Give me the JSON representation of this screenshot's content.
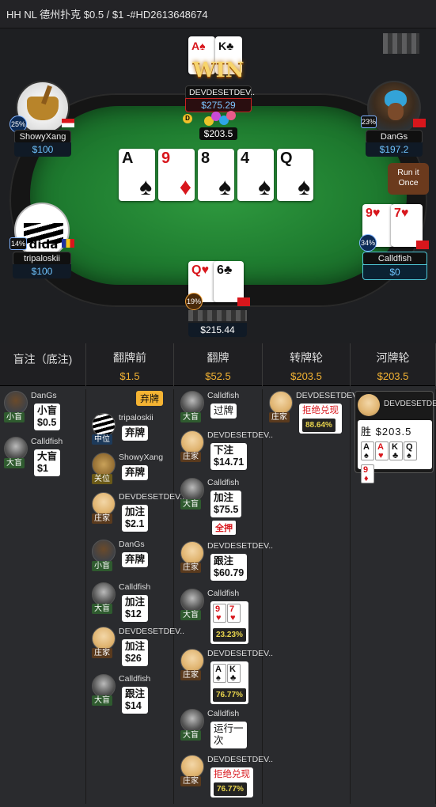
{
  "header": {
    "title": "HH NL 德州扑克 $0.5 / $1 -#HD2613648674"
  },
  "table": {
    "board": [
      {
        "rank": "A",
        "suit": "♠",
        "color": "#111111"
      },
      {
        "rank": "9",
        "suit": "♦",
        "color": "#d8161c"
      },
      {
        "rank": "8",
        "suit": "♠",
        "color": "#111111"
      },
      {
        "rank": "4",
        "suit": "♠",
        "color": "#111111"
      },
      {
        "rank": "Q",
        "suit": "♠",
        "color": "#111111"
      }
    ],
    "pot": "$203.5",
    "dealer_button": "D",
    "run_it_once": "Run it Once",
    "win_label": "WIN",
    "seats": {
      "top": {
        "name": "DEVDESETDEV..",
        "stack": "$275.29",
        "cards": [
          "A♠",
          "K♣"
        ]
      },
      "upper_left": {
        "name": "ShowyXang",
        "stack": "$100",
        "pct": "25%"
      },
      "upper_right": {
        "name": "DanGs",
        "stack": "$197.2",
        "pct": "23%"
      },
      "mid_left": {
        "name": "tripaloskii",
        "stack": "$100",
        "pct": "14%"
      },
      "mid_right": {
        "name": "Calldfish",
        "stack": "$0",
        "pct": "34%",
        "cards": [
          "9♥",
          "7♥"
        ]
      },
      "bottom": {
        "stack": "$215.44",
        "pct": "19%",
        "cards": [
          "Q♥",
          "6♣"
        ]
      }
    }
  },
  "history": {
    "columns": [
      {
        "title": "盲注（底注)",
        "value": ""
      },
      {
        "title": "翻牌前",
        "value": "$1.5"
      },
      {
        "title": "翻牌",
        "value": "$52.5"
      },
      {
        "title": "转牌轮",
        "value": "$203.5"
      },
      {
        "title": "河牌轮",
        "value": "$203.5"
      }
    ],
    "blinds": [
      {
        "name": "DanGs",
        "role": "小盲",
        "action": "小盲\n$0.5"
      },
      {
        "name": "Calldfish",
        "role": "大盲",
        "action": "大盲\n$1"
      }
    ],
    "preflop_tag": "弃牌",
    "preflop": [
      {
        "name": "tripaloskii",
        "role": "中位",
        "action": "弃牌"
      },
      {
        "name": "ShowyXang",
        "role": "关位",
        "action": "弃牌"
      },
      {
        "name": "DEVDESETDEV..",
        "role": "庄家",
        "action": "加注\n$2.1"
      },
      {
        "name": "DanGs",
        "role": "小盲",
        "action": "弃牌"
      },
      {
        "name": "Calldfish",
        "role": "大盲",
        "action": "加注\n$12"
      },
      {
        "name": "DEVDESETDEV..",
        "role": "庄家",
        "action": "加注\n$26"
      },
      {
        "name": "Calldfish",
        "role": "大盲",
        "action": "跟注\n$14"
      }
    ],
    "flop": [
      {
        "name": "Calldfish",
        "role": "大盲",
        "action": "过牌"
      },
      {
        "name": "DEVDESETDEV..",
        "role": "庄家",
        "action": "下注\n$14.71"
      },
      {
        "name": "Calldfish",
        "role": "大盲",
        "action": "加注\n$75.5",
        "allin": "全押"
      },
      {
        "name": "DEVDESETDEV..",
        "role": "庄家",
        "action": "跟注\n$60.79"
      },
      {
        "name": "Calldfish",
        "role": "大盲",
        "cards": [
          "9♥",
          "7♥"
        ],
        "equity": "23.23%"
      },
      {
        "name": "DEVDESETDEV..",
        "role": "庄家",
        "cards": [
          "A♠",
          "K♣"
        ],
        "equity": "76.77%"
      },
      {
        "name": "Calldfish",
        "role": "大盲",
        "action": "运行一\n次"
      },
      {
        "name": "DEVDESETDEV..",
        "role": "庄家",
        "action": "拒绝兑现",
        "equity": "76.77%"
      }
    ],
    "turn": [
      {
        "name": "DEVDESETDEV..",
        "role": "庄家",
        "action": "拒绝兑现",
        "equity": "88.64%"
      }
    ],
    "river": {
      "name": "DEVDESETDEV..",
      "result": "胜 $203.5",
      "cards": [
        "A♠",
        "A♥",
        "K♣",
        "Q♠",
        "9♦"
      ]
    }
  }
}
